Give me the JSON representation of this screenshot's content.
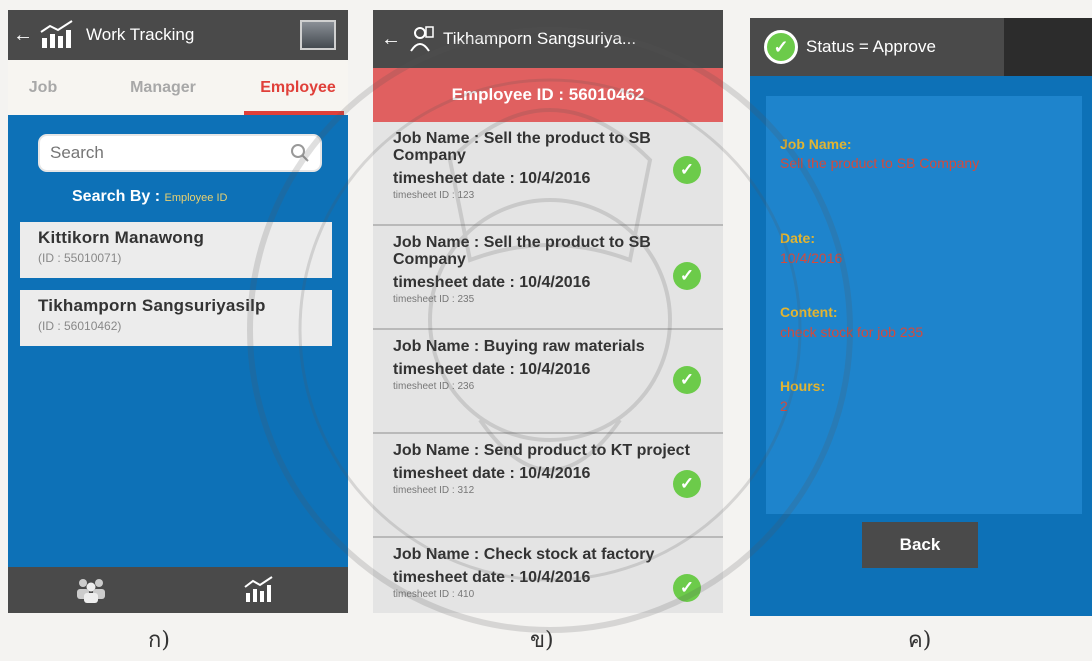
{
  "screen1": {
    "title": "Work Tracking",
    "back_icon": "←",
    "tabs": [
      "Job",
      "Manager",
      "Employee"
    ],
    "active_tab": 2,
    "search_placeholder": "Search",
    "search_by_label": "Search By :",
    "search_by_value": "Employee ID",
    "employees": [
      {
        "name": "Kittikorn  Manawong",
        "id": "(ID : 55010071)"
      },
      {
        "name": "Tikhamporn  Sangsuriyasilp",
        "id": "(ID : 56010462)"
      }
    ],
    "bottom_nav": [
      "people-icon",
      "chart-icon"
    ],
    "colors": {
      "topbar": "#4a4a4a",
      "bg": "#0d71b7",
      "accent": "#e0403a"
    }
  },
  "screen2": {
    "title": "Tikhamporn  Sangsuriya...",
    "back_icon": "←",
    "employee_id": "Employee ID : 56010462",
    "timesheets": [
      {
        "job_name": "Job Name : Sell the product to SB Company",
        "date": "timesheet date : 10/4/2016",
        "id": "timesheet ID : 123"
      },
      {
        "job_name": "Job Name : Sell the product to SB Company",
        "date": "timesheet date : 10/4/2016",
        "id": "timesheet ID : 235"
      },
      {
        "job_name": "Job Name : Buying raw materials",
        "date": "timesheet date : 10/4/2016",
        "id": "timesheet ID : 236"
      },
      {
        "job_name": "Job Name : Send product to KT project",
        "date": "timesheet date : 10/4/2016",
        "id": "timesheet ID : 312"
      },
      {
        "job_name": "Job Name : Check stock at factory",
        "date": "timesheet date : 10/4/2016",
        "id": "timesheet ID : 410"
      }
    ],
    "colors": {
      "header": "#e06060",
      "check": "#6ccb4a"
    }
  },
  "screen3": {
    "title": "Status = Approve",
    "fields": {
      "job_label": "Job Name:",
      "job_value": "Sell the product to SB Company",
      "date_label": "Date:",
      "date_value": "10/4/2016",
      "content_label": "Content:",
      "content_value": "check stock for job 235",
      "hours_label": "Hours:",
      "hours_value": "2"
    },
    "back_button": "Back",
    "colors": {
      "label": "#e2b431",
      "value": "#d44a3c"
    }
  },
  "captions": [
    "ก)",
    "ข)",
    "ค)"
  ]
}
